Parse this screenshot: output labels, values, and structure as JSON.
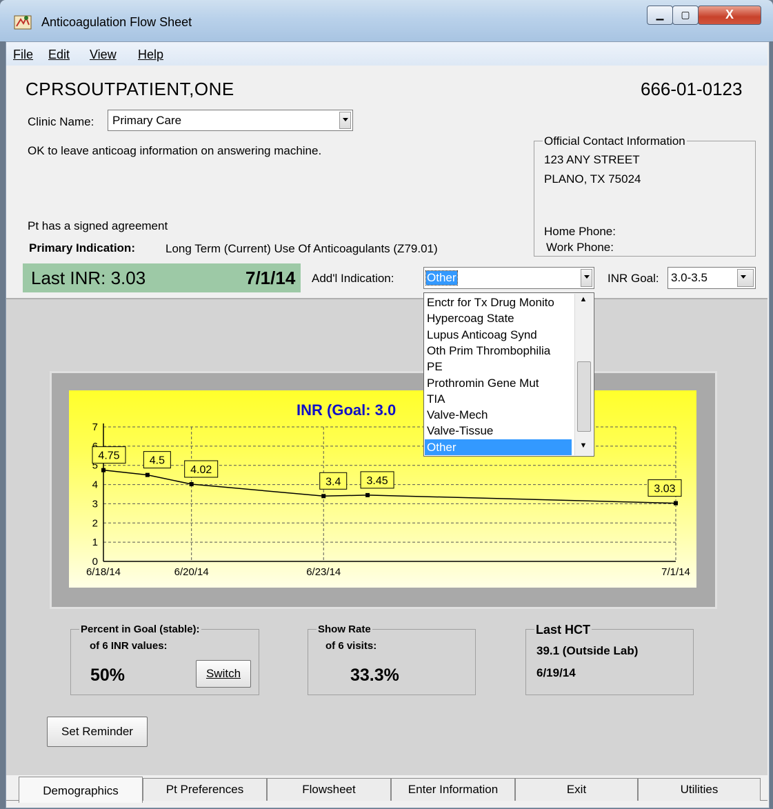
{
  "window": {
    "title": "Anticoagulation Flow Sheet",
    "minimize_glyph": "▁",
    "maximize_glyph": "▢",
    "close_glyph": "X"
  },
  "menu": {
    "file": "File",
    "edit": "Edit",
    "view": "View",
    "help": "Help"
  },
  "patient": {
    "name": "CPRSOUTPATIENT,ONE",
    "ssn": "666-01-0123"
  },
  "clinic": {
    "label": "Clinic Name:",
    "value": "Primary Care"
  },
  "notes": {
    "answering_machine": "OK to leave anticoag information on answering machine.",
    "agreement": "Pt has a signed agreement"
  },
  "indication": {
    "primary_label": "Primary Indication:",
    "primary_value": "Long Term (Current) Use Of Anticoagulants (Z79.01)",
    "addl_label": "Add'l Indication:",
    "addl_value": "Other",
    "options": [
      "Enctr for Tx Drug Monito",
      "Hypercoag State",
      "Lupus Anticoag Synd",
      "Oth Prim Thrombophilia",
      "PE",
      "Prothromin Gene Mut",
      "TIA",
      "Valve-Mech",
      "Valve-Tissue",
      "Other"
    ],
    "selected_index": 9
  },
  "contact": {
    "title": "Official Contact Information",
    "street": "123 ANY STREET",
    "city": "PLANO,  TX  75024",
    "home_phone": "Home Phone:",
    "work_phone": "Work Phone:"
  },
  "last_inr": {
    "label": "Last INR:  3.03",
    "date": "7/1/14"
  },
  "inr_goal": {
    "label": "INR Goal:",
    "value": "3.0-3.5"
  },
  "chart_data": {
    "type": "line",
    "title": "INR  (Goal: 3.0",
    "x": [
      "6/18/14",
      "6/19/14",
      "6/20/14",
      "6/23/14",
      "6/24/14",
      "7/1/14"
    ],
    "values": [
      4.75,
      4.5,
      4.02,
      3.4,
      3.45,
      3.03
    ],
    "value_labels": [
      "4.75",
      "4.5",
      "4.02",
      "3.4",
      "3.45",
      "3.03"
    ],
    "x_tick_labels": [
      "6/18/14",
      "6/20/14",
      "6/23/14",
      "7/1/14"
    ],
    "y_ticks": [
      "0",
      "1",
      "2",
      "3",
      "4",
      "5",
      "6",
      "7"
    ],
    "ylim": [
      0,
      7
    ],
    "grid": true,
    "line_color": "#000000",
    "background_color": "#ffff2b",
    "title_color": "#1010c8"
  },
  "stats": {
    "percent_goal_title": "Percent in Goal (stable):",
    "percent_goal_sub": "of 6 INR values:",
    "percent_goal_value": "50%",
    "switch_label": "Switch",
    "show_rate_title": "Show Rate",
    "show_rate_sub": "of 6 visits:",
    "show_rate_value": "33.3%",
    "hct_title": "Last HCT",
    "hct_value": "39.1 (Outside Lab)",
    "hct_date": "6/19/14"
  },
  "reminder_button": "Set Reminder",
  "tabs": [
    "Demographics",
    "Pt Preferences",
    "Flowsheet",
    "Enter Information",
    "Exit",
    "Utilities"
  ],
  "colors": {
    "last_inr_band": "#9dc9a6",
    "selection": "#3399ff"
  }
}
